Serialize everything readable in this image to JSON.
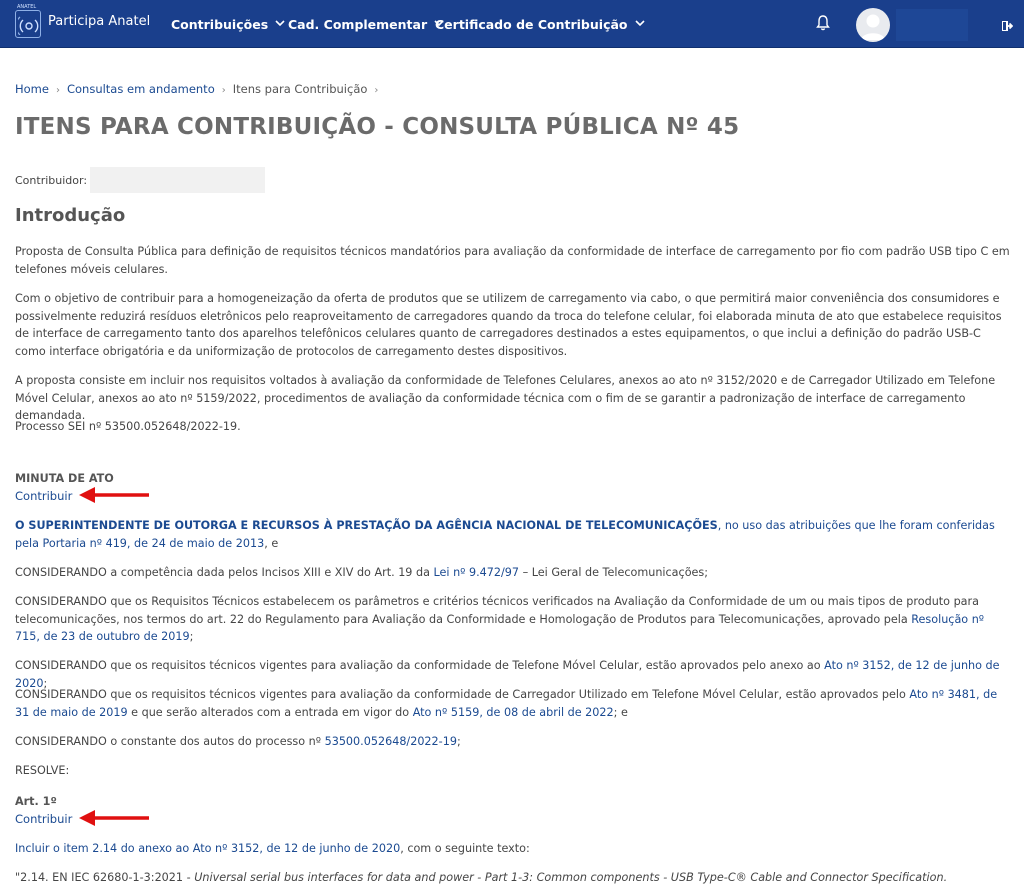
{
  "header": {
    "brand": "Participa Anatel",
    "logo_tiny_text": "ANATEL",
    "nav": [
      {
        "label": "Contribuições"
      },
      {
        "label": "Cad. Complementar"
      },
      {
        "label": "Certificado de Contribuição"
      }
    ],
    "icons": {
      "notifications": "bell-icon",
      "user": "user-avatar-icon",
      "logout": "logout-icon"
    }
  },
  "breadcrumb": [
    "Home",
    "Consultas em andamento",
    "Itens para Contribuição"
  ],
  "page_title": "ITENS PARA CONTRIBUIÇÃO - CONSULTA PÚBLICA Nº 45",
  "contributor_label": "Contribuidor:",
  "section_title": "Introdução",
  "intro": [
    "Proposta de Consulta Pública para definição de requisitos técnicos mandatórios para avaliação da conformidade de interface de carregamento por fio com padrão USB tipo C em telefones móveis celulares.",
    "Com o objetivo de contribuir para a homogeneização da oferta de produtos que se utilizem de carregamento via cabo, o que permitirá maior conveniência dos consumidores e possivelmente reduzirá resíduos eletrônicos pelo reaproveitamento de carregadores quando da troca do telefone celular, foi elaborada minuta de ato que estabelece requisitos de interface de carregamento tanto dos aparelhos telefônicos celulares quanto de carregadores destinados a estes equipamentos, o que inclui a definição do padrão USB-C como interface obrigatória e da uniformização de protocolos de carregamento destes dispositivos.",
    "A proposta consiste em incluir nos requisitos voltados à avaliação da conformidade de Telefones Celulares, anexos ao ato nº 3152/2020 e de Carregador Utilizado em Telefone Móvel Celular, anexos ao ato nº 5159/2022, procedimentos de avaliação da conformidade técnica com o fim de se garantir a padronização de interface de carregamento demandada.",
    "Processo SEI nº 53500.052648/2022-19."
  ],
  "minuta": {
    "heading": "MINUTA DE ATO",
    "contribuir": "Contribuir",
    "p1": {
      "strong": "O SUPERINTENDENTE DE OUTORGA E RECURSOS À PRESTAÇÃO DA AGÊNCIA NACIONAL DE TELECOMUNICAÇÕES",
      "link": ", no uso das atribuições que lhe foram conferidas pela Portaria nº 419, de 24 de maio de 2013",
      "tail": ", e"
    },
    "p2": {
      "a": "CONSIDERANDO a competência dada pelos Incisos XIII e XIV do Art. 19 da ",
      "link": "Lei nº 9.472/97",
      "b": " – Lei Geral de Telecomunicações;"
    },
    "p3": {
      "a": "CONSIDERANDO que os Requisitos Técnicos estabelecem os parâmetros e critérios técnicos verificados na Avaliação da Conformidade de um ou mais tipos de produto para telecomunicações, nos termos do art. 22 do Regulamento para Avaliação da Conformidade e Homologação de Produtos para Telecomunicações, aprovado pela ",
      "link": "Resolução nº 715, de 23 de outubro de 2019",
      "b": ";"
    },
    "p4": {
      "a": "CONSIDERANDO que os requisitos técnicos vigentes para avaliação da conformidade de Telefone Móvel Celular, estão aprovados pelo anexo ao ",
      "link": "Ato nº 3152, de 12 de junho de 2020",
      "b": ";"
    },
    "p5": {
      "a": "CONSIDERANDO que os requisitos técnicos vigentes para avaliação da conformidade de Carregador Utilizado em Telefone Móvel Celular, estão aprovados pelo ",
      "link1": "Ato nº 3481, de 31 de maio de 2019",
      "b": " e que serão alterados com a entrada em vigor do ",
      "link2": "Ato nº 5159, de 08 de abril de 2022",
      "c": "; e"
    },
    "p6": {
      "a": "CONSIDERANDO o constante dos autos do processo nº ",
      "link": "53500.052648/2022-19",
      "b": ";"
    },
    "resolve": "RESOLVE:"
  },
  "art1": {
    "heading": "Art. 1º",
    "contribuir": "Contribuir",
    "text": {
      "link1": "Incluir o item 2.14 do anexo ao ",
      "link2": "Ato nº 3152, de 12 de junho de 2020",
      "b": ", com o seguinte texto:"
    },
    "quote": {
      "a": "\"2.14. EN IEC 62680-1-3:2021 - ",
      "it": "Universal serial bus interfaces for data and power - Part 1-3: Common components - USB Type-C® Cable and Connector Specification."
    }
  },
  "colors": {
    "nav_bg": "#1a3f8c",
    "link": "#1b4a91",
    "arrow": "#e01010",
    "title": "#6b6b6b"
  }
}
